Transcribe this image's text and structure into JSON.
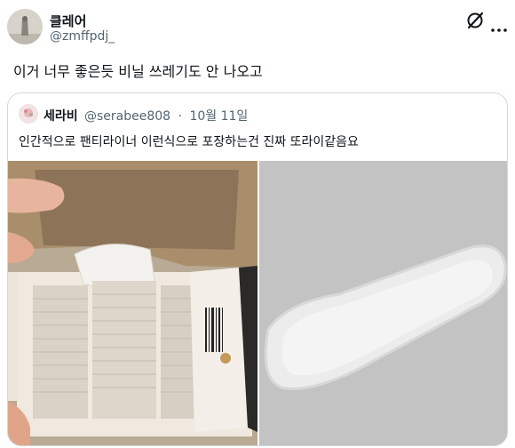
{
  "tweet": {
    "author_name": "클레어",
    "author_handle": "@zmffpdj_",
    "text": "이거 너무 좋은듯 비닐 쓰레기도 안 나오고"
  },
  "quoted_tweet": {
    "author_name": "세라비",
    "author_handle": "@serabee808",
    "separator": "·",
    "date": "10월 11일",
    "text": "인간적으로 팬티라이너 이런식으로 포장하는건 진짜 또라이같음요"
  },
  "icons": {
    "grok": "grok-slash-icon",
    "more": "more-dots-icon"
  },
  "colors": {
    "text_primary": "#0f1419",
    "text_secondary": "#536471",
    "border": "#cfd9de"
  }
}
